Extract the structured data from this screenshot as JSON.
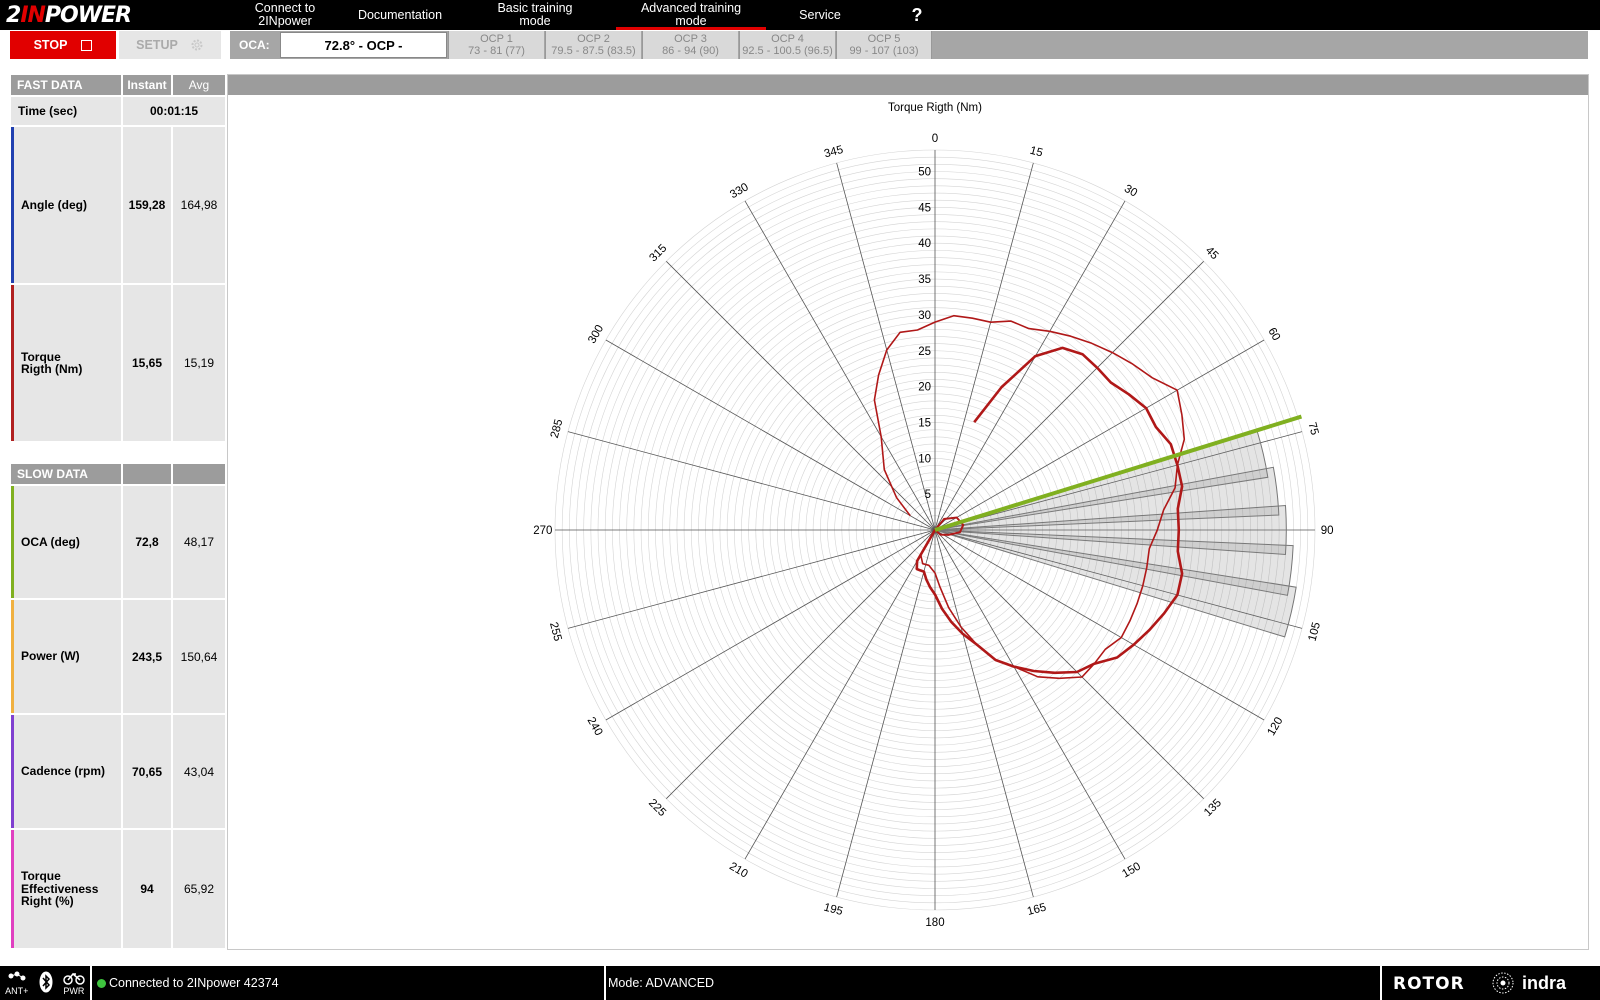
{
  "app": {
    "logo": {
      "part1": "2",
      "part2": "IN",
      "part3": "POWER"
    }
  },
  "nav": {
    "items": [
      {
        "label": "Connect to\n2INpower"
      },
      {
        "label": "Documentation"
      },
      {
        "label": "Basic training\nmode"
      },
      {
        "label": "Advanced training\nmode"
      },
      {
        "label": "Service"
      },
      {
        "label": "?"
      }
    ],
    "active_index": 3,
    "accent_color": "#e10000"
  },
  "toolbar": {
    "stop_label": "STOP",
    "setup_label": "SETUP",
    "oca_label": "OCA:",
    "oca_value": "72.8° - OCP -",
    "ocp": [
      {
        "title": "OCP 1",
        "range": "73 - 81 (77)"
      },
      {
        "title": "OCP 2",
        "range": "79.5 - 87.5 (83.5)"
      },
      {
        "title": "OCP 3",
        "range": "86 - 94 (90)"
      },
      {
        "title": "OCP 4",
        "range": "92.5 - 100.5 (96.5)"
      },
      {
        "title": "OCP 5",
        "range": "99 - 107 (103)"
      }
    ]
  },
  "fast_data": {
    "header": {
      "title": "FAST DATA",
      "instant": "Instant",
      "avg": "Avg"
    },
    "time_label": "Time (sec)",
    "time_value": "00:01:15",
    "rows": [
      {
        "label": "Angle (deg)",
        "instant": "159,28",
        "avg": "164,98",
        "color": "#2040b0"
      },
      {
        "label": "Torque\nRigth (Nm)",
        "instant": "15,65",
        "avg": "15,19",
        "color": "#b02020"
      }
    ]
  },
  "slow_data": {
    "header": {
      "title": "SLOW DATA"
    },
    "rows": [
      {
        "label": "OCA (deg)",
        "instant": "72,8",
        "avg": "48,17",
        "color": "#80b020"
      },
      {
        "label": "Power (W)",
        "instant": "243,5",
        "avg": "150,64",
        "color": "#f0b040"
      },
      {
        "label": "Cadence (rpm)",
        "instant": "70,65",
        "avg": "43,04",
        "color": "#8040d0"
      },
      {
        "label": "Torque\nEffectiveness\nRight (%)",
        "instant": "94",
        "avg": "65,92",
        "color": "#e040c0"
      }
    ]
  },
  "chart_data": {
    "type": "polar",
    "title": "Torque Rigth (Nm)",
    "angle_labels": [
      "0",
      "15",
      "30",
      "45",
      "60",
      "75",
      "90",
      "105",
      "120",
      "135",
      "150",
      "165",
      "180",
      "195",
      "210",
      "225",
      "240",
      "255",
      "270",
      "285",
      "300",
      "315",
      "330",
      "345"
    ],
    "radial_ticks": [
      "5",
      "10",
      "15",
      "20",
      "25",
      "30",
      "35",
      "40",
      "45",
      "50"
    ],
    "r_max": 53,
    "oca_deg": 72.8,
    "oca_color": "#80b020",
    "curve_color": "#b01818",
    "ocp_wedges": [
      {
        "from": 73,
        "to": 81,
        "r": 47
      },
      {
        "from": 79.5,
        "to": 87.5,
        "r": 48
      },
      {
        "from": 86,
        "to": 94,
        "r": 49
      },
      {
        "from": 92.5,
        "to": 100.5,
        "r": 50
      },
      {
        "from": 99,
        "to": 107,
        "r": 51
      }
    ],
    "series": [
      {
        "points": [
          [
            20,
            16
          ],
          [
            25,
            22
          ],
          [
            30,
            28
          ],
          [
            35,
            31
          ],
          [
            40,
            32
          ],
          [
            45,
            32
          ],
          [
            50,
            32
          ],
          [
            55,
            33
          ],
          [
            60,
            34
          ],
          [
            65,
            34
          ],
          [
            70,
            35
          ],
          [
            75,
            35
          ],
          [
            80,
            35
          ],
          [
            85,
            34
          ],
          [
            90,
            34
          ],
          [
            95,
            34
          ],
          [
            100,
            35
          ],
          [
            105,
            35
          ],
          [
            110,
            34
          ],
          [
            115,
            33
          ],
          [
            120,
            32
          ],
          [
            125,
            31
          ],
          [
            130,
            29
          ],
          [
            135,
            28
          ],
          [
            140,
            26
          ],
          [
            145,
            24
          ],
          [
            150,
            22
          ],
          [
            155,
            20
          ],
          [
            160,
            17
          ],
          [
            165,
            15
          ],
          [
            170,
            13
          ],
          [
            175,
            11
          ],
          [
            180,
            9
          ],
          [
            185,
            8
          ],
          [
            190,
            7
          ],
          [
            195,
            6
          ],
          [
            200,
            6
          ],
          [
            205,
            6
          ],
          [
            210,
            5
          ]
        ]
      },
      {
        "points": [
          [
            300,
            4
          ],
          [
            310,
            7
          ],
          [
            320,
            11
          ],
          [
            330,
            15
          ],
          [
            335,
            20
          ],
          [
            340,
            23
          ],
          [
            345,
            26
          ],
          [
            350,
            28
          ],
          [
            355,
            28
          ],
          [
            0,
            29
          ],
          [
            5,
            30
          ],
          [
            10,
            30
          ],
          [
            15,
            30
          ],
          [
            20,
            31
          ],
          [
            25,
            31
          ],
          [
            30,
            32
          ],
          [
            35,
            33
          ],
          [
            40,
            34
          ],
          [
            45,
            35
          ],
          [
            50,
            36
          ],
          [
            55,
            37
          ],
          [
            60,
            39
          ],
          [
            65,
            38
          ],
          [
            70,
            37
          ],
          [
            75,
            35
          ],
          [
            80,
            34
          ],
          [
            85,
            32
          ],
          [
            90,
            31
          ],
          [
            95,
            30
          ],
          [
            100,
            30
          ],
          [
            105,
            30
          ],
          [
            110,
            30
          ],
          [
            115,
            30
          ],
          [
            120,
            30
          ],
          [
            125,
            29
          ],
          [
            130,
            29
          ],
          [
            135,
            29
          ],
          [
            140,
            27
          ],
          [
            145,
            25
          ],
          [
            150,
            22
          ],
          [
            155,
            20
          ],
          [
            160,
            17
          ],
          [
            165,
            14
          ],
          [
            170,
            11
          ],
          [
            175,
            8
          ],
          [
            180,
            6
          ],
          [
            190,
            5
          ],
          [
            200,
            5
          ],
          [
            210,
            4
          ]
        ]
      }
    ]
  },
  "status": {
    "icons": [
      {
        "name": "ant-icon",
        "label": "ANT+"
      },
      {
        "name": "bluetooth-icon",
        "label": ""
      },
      {
        "name": "bike-power-icon",
        "label": "PWR"
      }
    ],
    "connection": "Connected to 2INpower 42374",
    "mode": "Mode: ADVANCED",
    "brand1": "ROTOR",
    "brand2": "indra",
    "connected_color": "#3ec43e"
  }
}
